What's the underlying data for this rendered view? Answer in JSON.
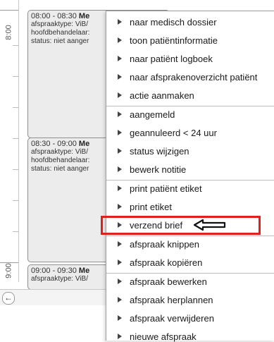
{
  "agenda": {
    "times": [
      "8:00",
      "9:00"
    ],
    "appointments": [
      {
        "time": "08:00 - 08:30",
        "title": "Me",
        "type": "afspraaktype: ViB/",
        "practitioner": "hoofdbehandelaar:",
        "status": "status: niet aanger"
      },
      {
        "time": "08:30 - 09:00",
        "title": "Me",
        "type": "afspraaktype: ViB/",
        "practitioner": "hoofdbehandelaar:",
        "status": "status: niet aanger"
      },
      {
        "time": "09:00 - 09:30",
        "title": "Me",
        "type": "afspraaktype: ViB/"
      }
    ],
    "nav_icon": "back-arrow-icon"
  },
  "context_menu": {
    "items": [
      "naar medisch dossier",
      "toon patiëntinformatie",
      "naar patiënt logboek",
      "naar afsprakenoverzicht patiënt",
      "actie aanmaken",
      "aangemeld",
      "geannuleerd < 24 uur",
      "status wijzigen",
      "bewerk notitie",
      "print patiënt etiket",
      "print etiket",
      "verzend brief",
      "afspraak knippen",
      "afspraak kopiëren",
      "afspraak bewerken",
      "afspraak herplannen",
      "afspraak verwijderen",
      "nieuwe afspraak"
    ],
    "highlighted_item": "verzend brief",
    "highlight_color": "#e02020"
  }
}
